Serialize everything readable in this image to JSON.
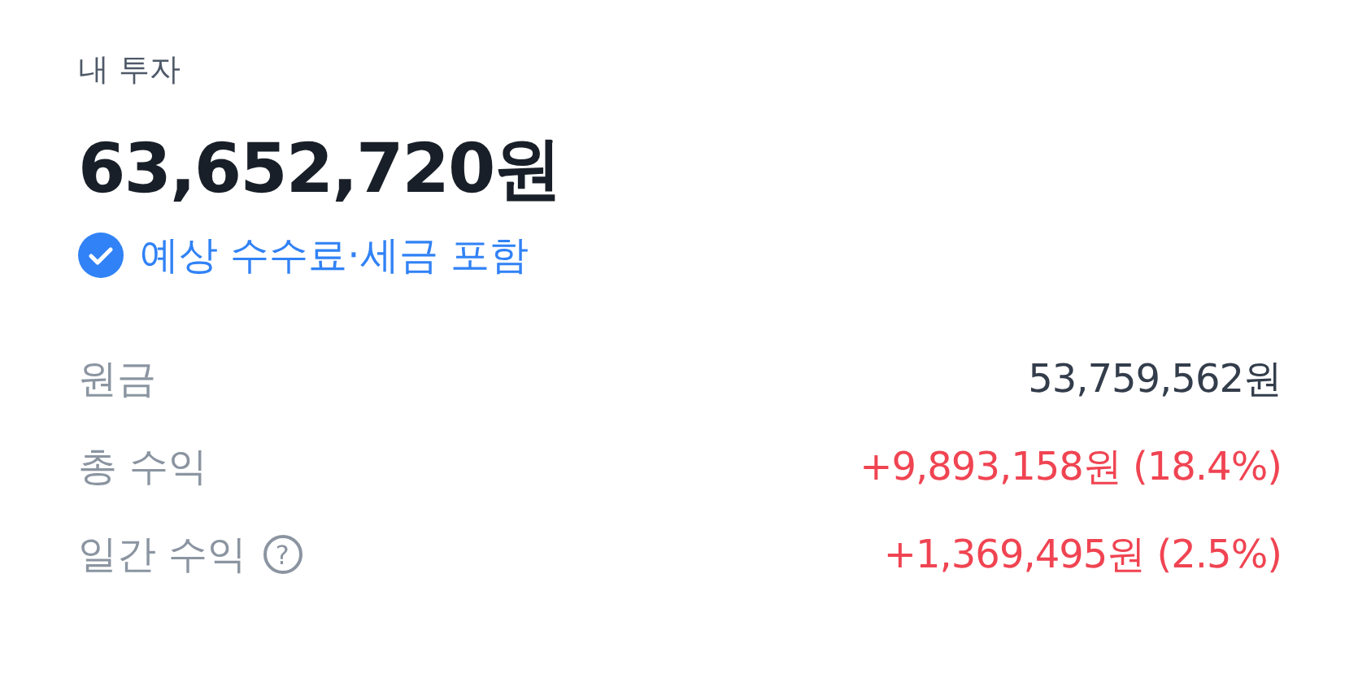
{
  "title": "내 투자",
  "total": "63,652,720원",
  "fee_notice": {
    "label": "예상 수수료·세금 포함",
    "checked": true
  },
  "rows": [
    {
      "label": "원금",
      "value": "53,759,562원",
      "kind": "neutral"
    },
    {
      "label": "총 수익",
      "value": "+9,893,158원 (18.4%)",
      "kind": "gain"
    },
    {
      "label": "일간 수익",
      "help": "?",
      "value": "+1,369,495원 (2.5%)",
      "kind": "gain"
    }
  ]
}
